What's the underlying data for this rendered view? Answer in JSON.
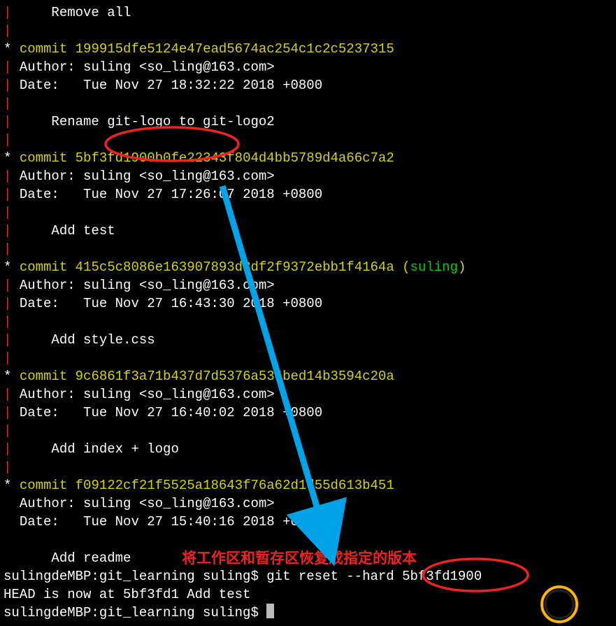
{
  "partial_top": {
    "msg": "    Remove all"
  },
  "commits": [
    {
      "hash": "199915dfe5124e47ead5674ac254c1c2c5237315",
      "author": "suling <so_ling@163.com>",
      "date": "Tue Nov 27 18:32:22 2018 +0800",
      "message": "    Rename git-logo to git-logo2",
      "ref": ""
    },
    {
      "hash": "5bf3fd1900b0fe22343f804d4bb5789d4a66c7a2",
      "author": "suling <so_ling@163.com>",
      "date": "Tue Nov 27 17:26:07 2018 +0800",
      "message": "    Add test",
      "ref": ""
    },
    {
      "hash": "415c5c8086e163907893d3df2f9372ebb1f4164a",
      "author": "suling <so_ling@163.com>",
      "date": "Tue Nov 27 16:43:30 2018 +0800",
      "message": "    Add style.css",
      "ref": "suling"
    },
    {
      "hash": "9c6861f3a71b437d7d5376a534bed14b3594c20a",
      "author": "suling <so_ling@163.com>",
      "date": "Tue Nov 27 16:40:02 2018 +0800",
      "message": "    Add index + logo",
      "ref": ""
    },
    {
      "hash": "f09122cf21f5525a18643f76a62d1d55d613b451",
      "author": "suling <so_ling@163.com>",
      "date": "Tue Nov 27 15:40:16 2018 +0800",
      "message": "    Add readme",
      "ref": ""
    }
  ],
  "labels": {
    "commit": "commit",
    "author": "Author:",
    "date": "Date:  "
  },
  "prompt": {
    "prefix": "sulingdeMBP:git_learning suling$ ",
    "command": "git reset --hard 5bf3fd1900"
  },
  "output": {
    "head_now": "HEAD is now at 5bf3fd1 Add test"
  },
  "prompt2": {
    "prefix": "sulingdeMBP:git_learning suling$ "
  },
  "annotation": {
    "text": "将工作区和暂存区恢复成指定的版本"
  },
  "colors": {
    "pipe": "#cc3333",
    "hash": "#d4d400",
    "ref": "#00cc00",
    "overlay_arrow": "#00a2e8",
    "overlay_circle": "#ee2222",
    "cursor_ring_outer": "#ffb400",
    "cursor_ring_inner": "#333333"
  }
}
